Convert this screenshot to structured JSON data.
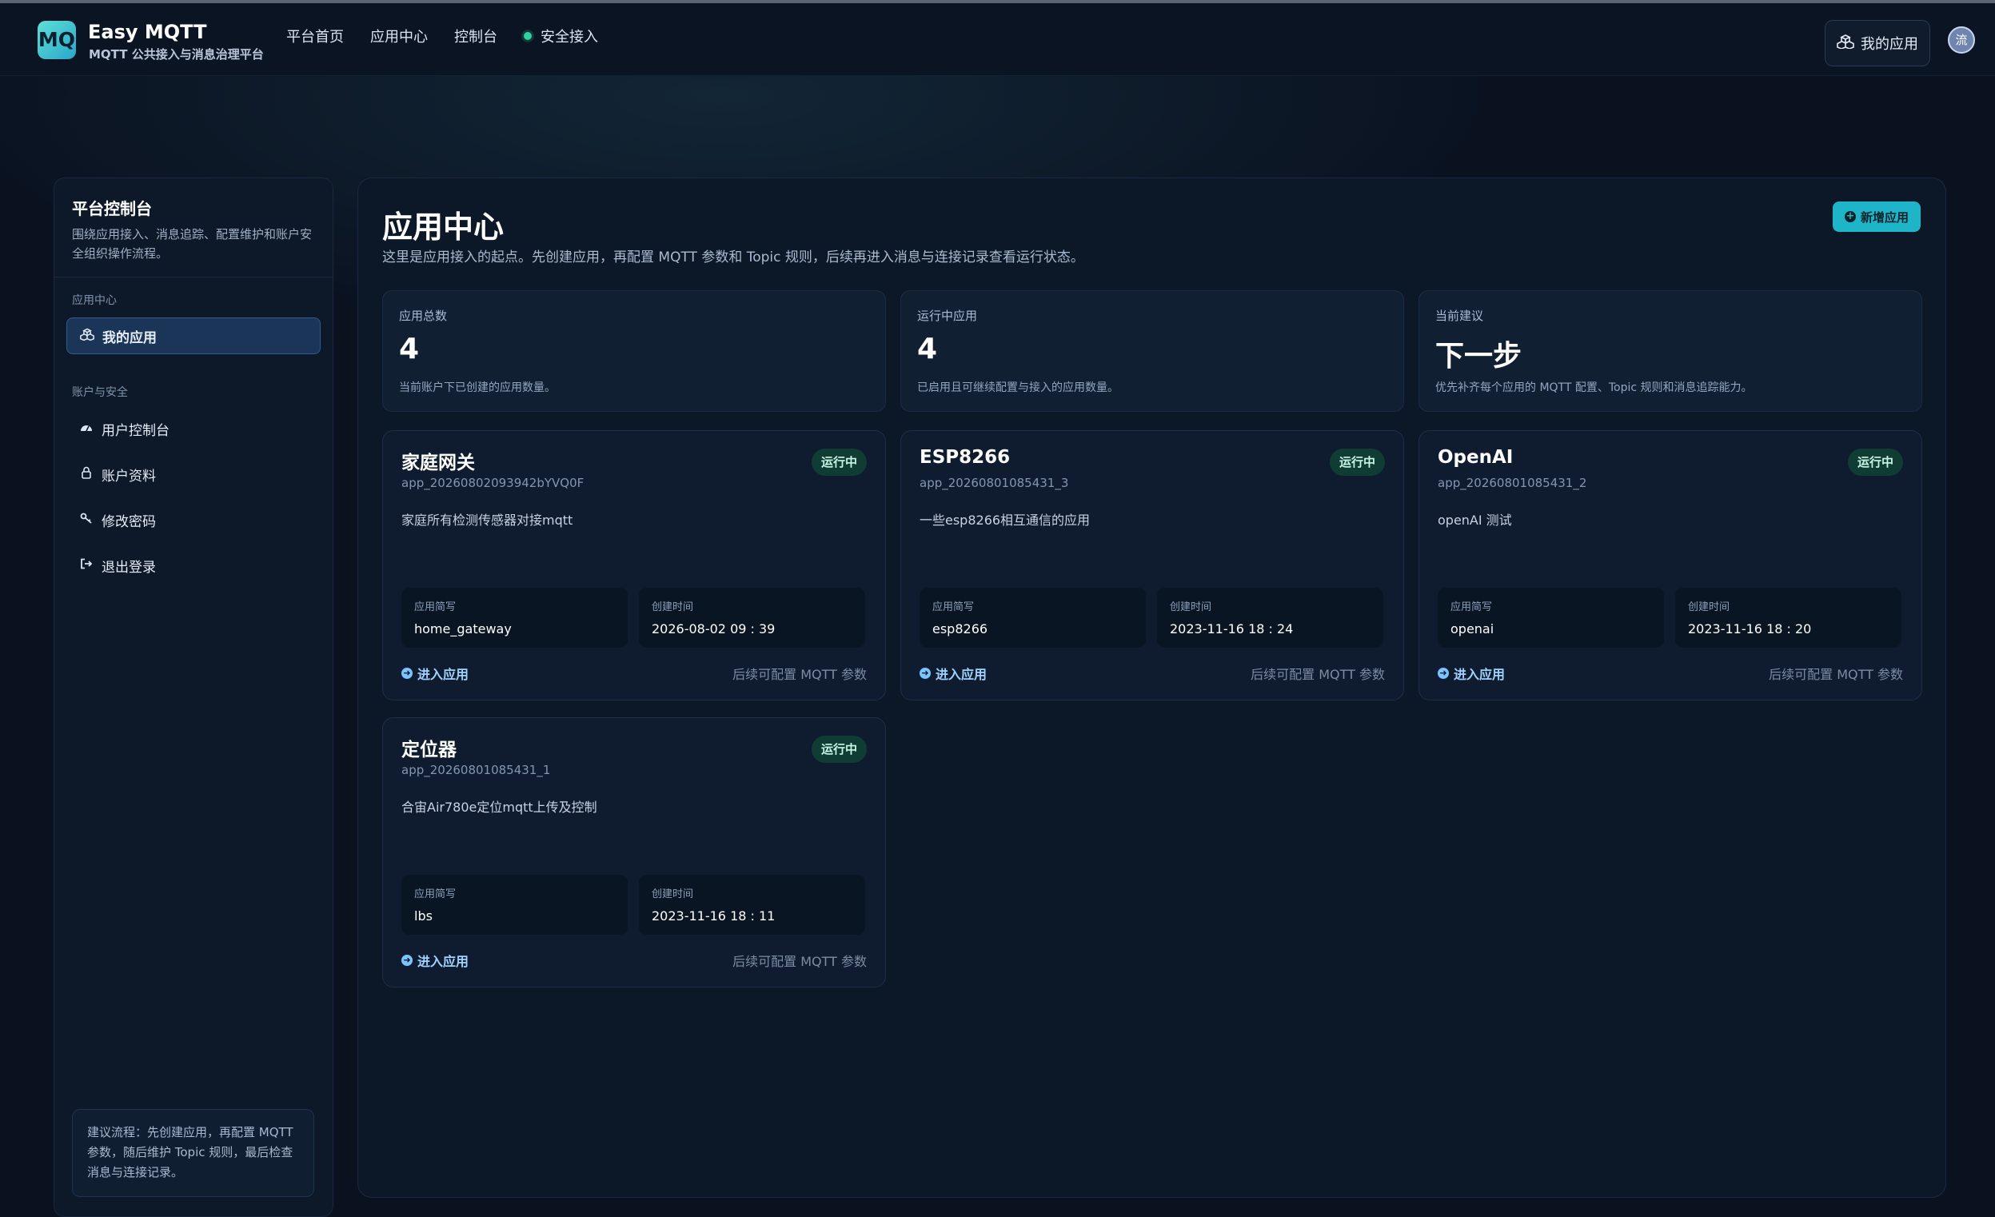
{
  "header": {
    "logo_text": "MQ",
    "brand_title": "Easy MQTT",
    "brand_subtitle": "MQTT 公共接入与消息治理平台",
    "nav": [
      "平台首页",
      "应用中心",
      "控制台",
      "安全接入"
    ],
    "my_apps_button": "我的应用",
    "avatar_text": "流"
  },
  "sidebar": {
    "title": "平台控制台",
    "description": "围绕应用接入、消息追踪、配置维护和账户安全组织操作流程。",
    "group_apps": "应用中心",
    "my_apps": "我的应用",
    "group_account": "账户与安全",
    "items": [
      "用户控制台",
      "账户资料",
      "修改密码",
      "退出登录"
    ],
    "tip": "建议流程：先创建应用，再配置 MQTT 参数，随后维护 Topic 规则，最后检查消息与连接记录。"
  },
  "main": {
    "title": "应用中心",
    "description": "这里是应用接入的起点。先创建应用，再配置 MQTT 参数和 Topic 规则，后续再进入消息与连接记录查看运行状态。",
    "new_app_button": "新增应用",
    "stats": [
      {
        "label": "应用总数",
        "value": "4",
        "note": "当前账户下已创建的应用数量。"
      },
      {
        "label": "运行中应用",
        "value": "4",
        "note": "已启用且可继续配置与接入的应用数量。"
      },
      {
        "label": "当前建议",
        "value": "下一步",
        "note": "优先补齐每个应用的 MQTT 配置、Topic 规则和消息追踪能力。"
      }
    ],
    "card_labels": {
      "short_name": "应用简写",
      "created": "创建时间",
      "enter": "进入应用",
      "hint": "后续可配置 MQTT 参数"
    },
    "apps": [
      {
        "name": "家庭网关",
        "id": "app_20260802093942bYVQ0F",
        "status": "运行中",
        "description": "家庭所有检测传感器对接mqtt",
        "short": "home_gateway",
        "created": "2026-08-02 09 : 39"
      },
      {
        "name": "ESP8266",
        "id": "app_20260801085431_3",
        "status": "运行中",
        "description": "一些esp8266相互通信的应用",
        "short": "esp8266",
        "created": "2023-11-16 18 : 24"
      },
      {
        "name": "OpenAI",
        "id": "app_20260801085431_2",
        "status": "运行中",
        "description": "openAI 测试",
        "short": "openai",
        "created": "2023-11-16 18 : 20"
      },
      {
        "name": "定位器",
        "id": "app_20260801085431_1",
        "status": "运行中",
        "description": "合宙Air780e定位mqtt上传及控制",
        "short": "lbs",
        "created": "2023-11-16 18 : 11"
      }
    ]
  },
  "icons": {
    "status_dot": "green-dot-icon",
    "apps": "cubes-icon",
    "dashboard": "gauge-icon",
    "profile": "user-icon",
    "password": "key-icon",
    "logout": "sign-out-icon",
    "enter": "arrow-circle-right-icon",
    "add": "plus-circle-icon"
  },
  "colors": {
    "accent": "#1fb5c8",
    "running_badge": "#0f3d34",
    "background": "#0a1220"
  }
}
